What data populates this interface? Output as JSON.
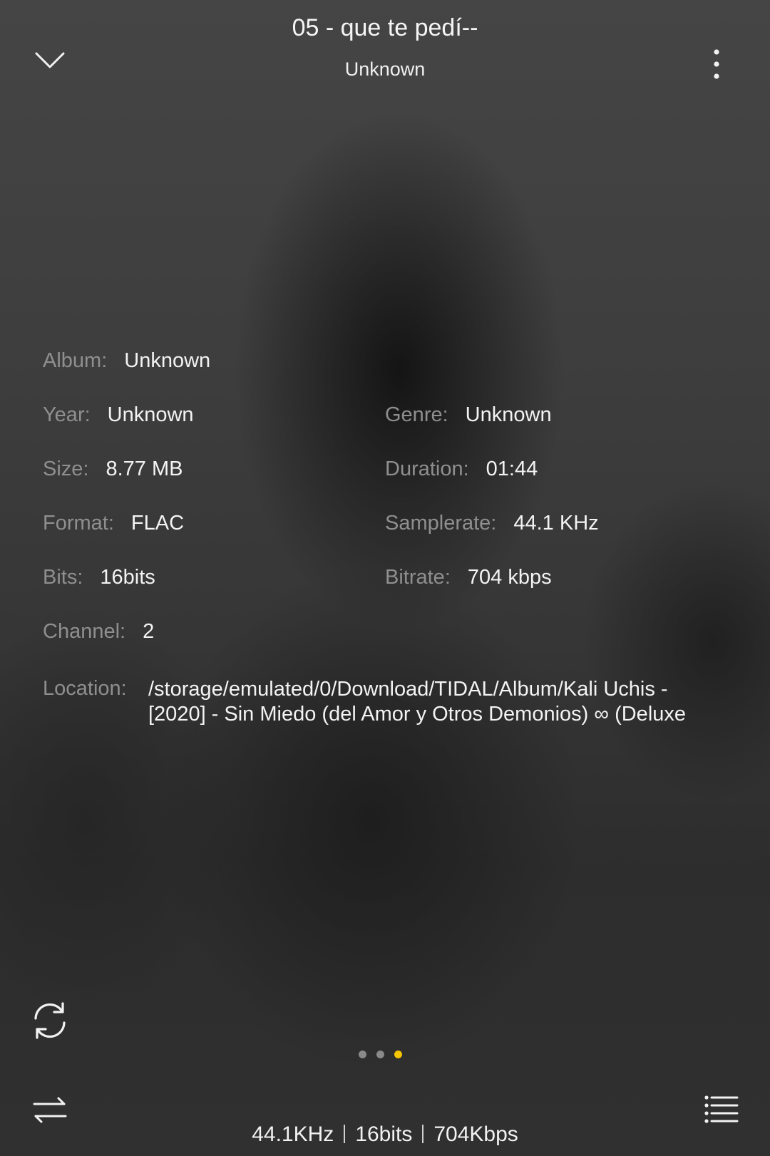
{
  "header": {
    "title": "05 - que te pedí--",
    "artist": "Unknown",
    "collapse_icon": "chevron-down-icon",
    "more_icon": "more-vertical-icon"
  },
  "details": {
    "album_label": "Album:",
    "album": "Unknown",
    "year_label": "Year:",
    "year": "Unknown",
    "genre_label": "Genre:",
    "genre": "Unknown",
    "size_label": "Size:",
    "size": "8.77 MB",
    "duration_label": "Duration:",
    "duration": "01:44",
    "format_label": "Format:",
    "format": "FLAC",
    "samplerate_label": "Samplerate:",
    "samplerate": "44.1 KHz",
    "bits_label": "Bits:",
    "bits": "16bits",
    "bitrate_label": "Bitrate:",
    "bitrate": "704 kbps",
    "channel_label": "Channel:",
    "channel": "2",
    "location_label": "Location:",
    "location": "/storage/emulated/0/Download/TIDAL/Album/Kali Uchis - [2020] - Sin Miedo (del Amor y Otros Demonios) ∞ (Deluxe"
  },
  "pager": {
    "count": 3,
    "active_index": 2,
    "active_color": "#f5c400",
    "inactive_color": "#8a8a8a"
  },
  "footer": {
    "repeat_icon": "repeat-icon",
    "shuffle_icon": "play-order-icon",
    "queue_icon": "playlist-icon",
    "quality": {
      "samplerate": "44.1KHz",
      "bits": "16bits",
      "bitrate": "704Kbps"
    }
  }
}
